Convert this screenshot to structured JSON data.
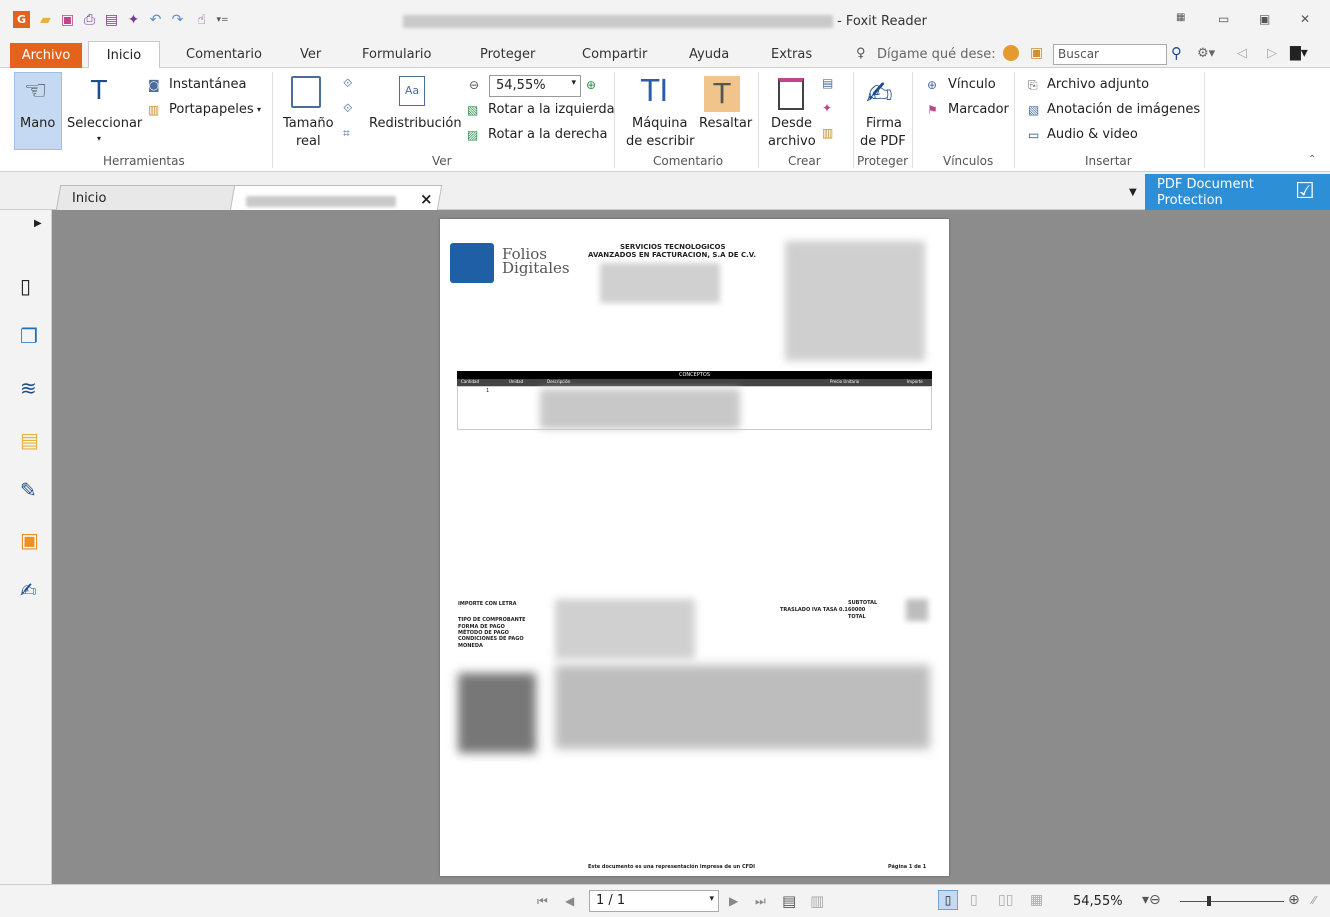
{
  "window": {
    "title_suffix": "- Foxit Reader"
  },
  "menu_tabs": {
    "archivo": "Archivo",
    "inicio": "Inicio",
    "comentario": "Comentario",
    "ver": "Ver",
    "formulario": "Formulario",
    "proteger": "Proteger",
    "compartir": "Compartir",
    "ayuda": "Ayuda",
    "extras": "Extras",
    "tell_me": "Dígame qué dese:",
    "search_placeholder": "Buscar"
  },
  "ribbon": {
    "mano": "Mano",
    "seleccionar": "Seleccionar",
    "instantanea": "Instantánea",
    "portapapeles": "Portapapeles",
    "herramientas": "Herramientas",
    "tamano_real_1": "Tamaño",
    "tamano_real_2": "real",
    "redistribucion": "Redistribución",
    "zoom_value": "54,55%",
    "rotar_izq": "Rotar a la izquierda",
    "rotar_der": "Rotar a la derecha",
    "ver": "Ver",
    "maquina_1": "Máquina",
    "maquina_2": "de escribir",
    "resaltar": "Resaltar",
    "comentario": "Comentario",
    "desde_1": "Desde",
    "desde_2": "archivo",
    "crear": "Crear",
    "firma_1": "Firma",
    "firma_2": "de PDF",
    "proteger": "Proteger",
    "vinculo": "Vínculo",
    "marcador": "Marcador",
    "vinculos": "Vínculos",
    "archivo_adjunto": "Archivo adjunto",
    "anotacion_imagenes": "Anotación de imágenes",
    "audio_video": "Audio & video",
    "insertar": "Insertar"
  },
  "doc_tabs": {
    "home": "Inicio",
    "close": "×"
  },
  "pdf_protection": {
    "line1": "PDF Document",
    "line2": "Protection"
  },
  "pdf": {
    "logo_top": "Folios",
    "logo_bottom": "Digitales",
    "company_1": "SERVICIOS TECNOLOGICOS",
    "company_2": "AVANZADOS EN FACTURACION, S.A DE C.V.",
    "conceptos": "CONCEPTOS",
    "col_cantidad": "Cantidad",
    "col_unidad": "Unidad",
    "col_descripcion": "Descripción",
    "col_precio": "Precio Unitario",
    "col_importe": "Importe",
    "row_qty": "1",
    "importe_letra": "IMPORTE CON LETRA",
    "tipo_comprobante": "TIPO DE COMPROBANTE",
    "forma_pago": "FORMA DE PAGO",
    "metodo_pago": "MÉTODO DE PAGO",
    "condiciones": "CONDICIONES DE PAGO",
    "moneda": "MONEDA",
    "subtotal": "SUBTOTAL",
    "traslado": "TRASLADO IVA TASA 0.160000",
    "total": "TOTAL",
    "footer": "Este documento es una representación impresa de un CFDI",
    "page": "Página 1 de 1"
  },
  "status": {
    "page_field": "1 / 1",
    "zoom": "54,55%"
  }
}
